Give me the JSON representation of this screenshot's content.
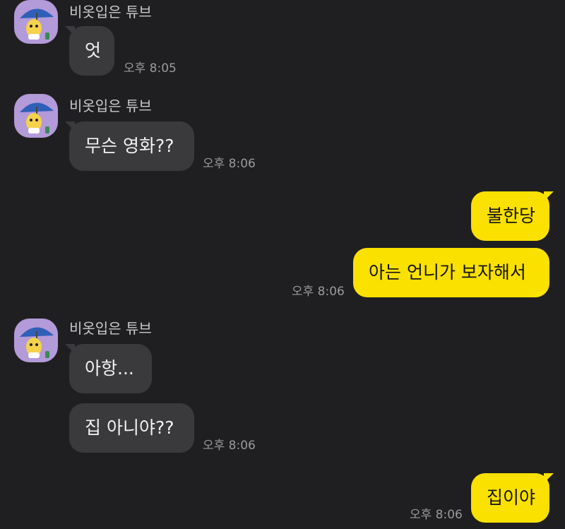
{
  "sender_name": "비옷입은 튜브",
  "messages": [
    {
      "text": "엇",
      "time": "오후 8:05"
    },
    {
      "text": "무슨 영화??",
      "time": "오후 8:06"
    },
    {
      "text": "불한당"
    },
    {
      "text": "아는 언니가 보자해서",
      "time": "오후 8:06"
    },
    {
      "text": "아항..."
    },
    {
      "text": "집 아니야??",
      "time": "오후 8:06"
    },
    {
      "text": "집이야",
      "time": "오후 8:06"
    }
  ],
  "colors": {
    "background": "#1f1f21",
    "incoming_bubble": "#3a3a3c",
    "outgoing_bubble": "#fae100",
    "avatar_bg": "#b39ad9"
  }
}
